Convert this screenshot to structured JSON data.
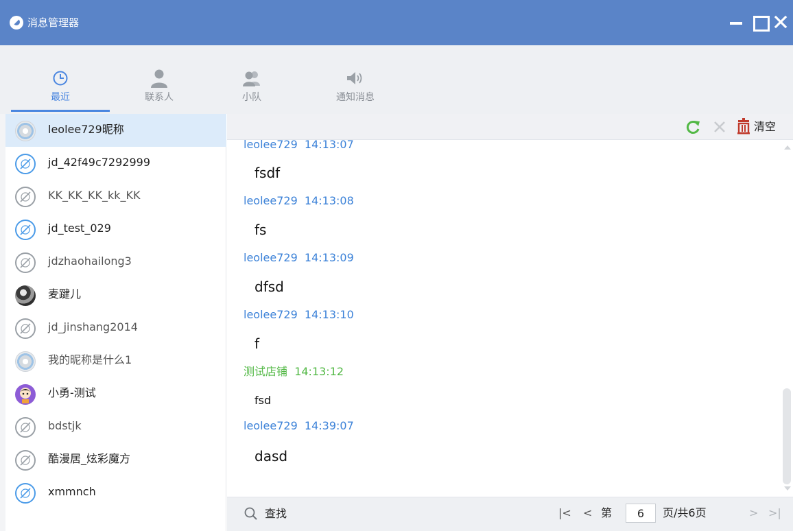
{
  "window": {
    "title": "消息管理器",
    "controls": [
      "minimize",
      "maximize",
      "close"
    ]
  },
  "tabs": [
    {
      "label": "最近",
      "icon": "clock-icon",
      "active": true
    },
    {
      "label": "联系人",
      "icon": "person-icon",
      "active": false
    },
    {
      "label": "小队",
      "icon": "team-icon",
      "active": false
    },
    {
      "label": "通知消息",
      "icon": "speaker-icon",
      "active": false
    }
  ],
  "contacts": [
    {
      "name": "leolee729昵称",
      "avatar": "gear",
      "selected": true
    },
    {
      "name": "jd_42f49c7292999",
      "avatar": "blue"
    },
    {
      "name": "KK_KK_KK_kk_KK",
      "avatar": "gray"
    },
    {
      "name": "jd_test_029",
      "avatar": "blue"
    },
    {
      "name": "jdzhaohailong3",
      "avatar": "gray"
    },
    {
      "name": "麦踺儿",
      "avatar": "dark"
    },
    {
      "name": "jd_jinshang2014",
      "avatar": "gray"
    },
    {
      "name": "我的昵称是什么1",
      "avatar": "gear"
    },
    {
      "name": "小勇-测试",
      "avatar": "purple"
    },
    {
      "name": "bdstjk",
      "avatar": "gray"
    },
    {
      "name": "酷漫居_炫彩魔方",
      "avatar": "gray"
    },
    {
      "name": "xmmnch",
      "avatar": "blue"
    }
  ],
  "toolbar": {
    "refresh_icon": "refresh-icon",
    "delete_icon": "delete-icon",
    "clear_label": "清空",
    "accent_green": "#52b845",
    "accent_red": "#c0392b"
  },
  "messages": [
    {
      "sender": "leolee729",
      "time": "14:13:07",
      "text": "fsdf",
      "color": "blue"
    },
    {
      "sender": "leolee729",
      "time": "14:13:08",
      "text": "fs",
      "color": "blue"
    },
    {
      "sender": "leolee729",
      "time": "14:13:09",
      "text": "dfsd",
      "color": "blue"
    },
    {
      "sender": "leolee729",
      "time": "14:13:10",
      "text": "f",
      "color": "blue"
    },
    {
      "sender": "测试店铺",
      "time": "14:13:12",
      "text": "fsd",
      "color": "green"
    },
    {
      "sender": "leolee729",
      "time": "14:39:07",
      "text": "dasd",
      "color": "blue"
    }
  ],
  "search": {
    "label": "查找"
  },
  "pagination": {
    "first": "|<",
    "prev": "<",
    "page_prefix": "第",
    "current_page": "6",
    "page_suffix": "页/共6页",
    "next": ">",
    "last": ">|"
  },
  "colors": {
    "titlebar": "#5a84c8",
    "accent_blue": "#4a86e0",
    "message_blue": "#3c82d8",
    "message_green": "#52b845"
  }
}
